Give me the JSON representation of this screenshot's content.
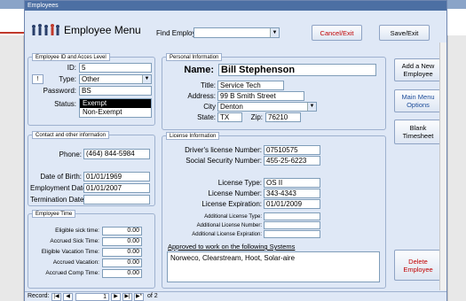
{
  "window_title": "Employees",
  "header": {
    "title": "Employee Menu",
    "find_label": "Find Employee:",
    "find_value": "",
    "cancel_label": "Cancel/Exit",
    "save_label": "Save/Exit"
  },
  "id_panel": {
    "title": "Employee ID and Acces Level",
    "id_label": "ID:",
    "id_value": "5",
    "type_label": "Type:",
    "type_value": "Other",
    "type_button": "!",
    "password_label": "Password:",
    "password_value": "BS",
    "status_label": "Status:",
    "status_options": [
      "Exempt",
      "Non-Exempt"
    ],
    "status_selected": "Exempt"
  },
  "contact_panel": {
    "title": "Contact and other information",
    "phone_label": "Phone:",
    "phone_value": "(464) 844-5984",
    "dob_label": "Date of Birth:",
    "dob_value": "01/01/1969",
    "emp_date_label": "Employment Date:",
    "emp_date_value": "01/01/2007",
    "term_label": "Termination Date:",
    "term_value": ""
  },
  "time_panel": {
    "title": "Employee Time",
    "rows": [
      {
        "label": "Eligible sick time:",
        "value": "0.00"
      },
      {
        "label": "Accrued Sick Time:",
        "value": "0.00"
      },
      {
        "label": "Eligible Vacation Time:",
        "value": "0.00"
      },
      {
        "label": "Accrued Vacation:",
        "value": "0.00"
      },
      {
        "label": "Accrued Comp Time:",
        "value": "0.00"
      }
    ]
  },
  "personal_panel": {
    "title": "Personal Information",
    "name_label": "Name:",
    "name_value": "Bill Stephenson",
    "title_label": "Title:",
    "title_value": "Service Tech",
    "address_label": "Address:",
    "address_value": "99 B Smith Street",
    "city_label": "City",
    "city_value": "Denton",
    "state_label": "State:",
    "state_value": "TX",
    "zip_label": "Zip:",
    "zip_value": "76210"
  },
  "license_panel": {
    "title": "License Information",
    "dl_label": "Driver's license Number:",
    "dl_value": "07510575",
    "ssn_label": "Social Security Number:",
    "ssn_value": "455-25-6223",
    "type_label": "License Type:",
    "type_value": "OS II",
    "num_label": "License Number:",
    "num_value": "343-4343",
    "exp_label": "License Expiration:",
    "exp_value": "01/01/2009",
    "add_type_label": "Additional License Type:",
    "add_num_label": "Additional License Number:",
    "add_exp_label": "Additional License Expiration:",
    "systems_heading": "Approved to work on the following Systems",
    "systems_value": "Norweco, Clearstream, Hoot, Solar-aire"
  },
  "side_buttons": {
    "add_new": "Add a New Employee",
    "main_menu": "Main Menu Options",
    "blank_ts": "Blank Timesheet",
    "delete": "Delete Employee"
  },
  "nav": {
    "record_label": "Record:",
    "current": "1",
    "of_text": "of 2",
    "first": "|◀",
    "prev": "◀",
    "next": "▶",
    "last": "▶|",
    "new": "▶*"
  }
}
